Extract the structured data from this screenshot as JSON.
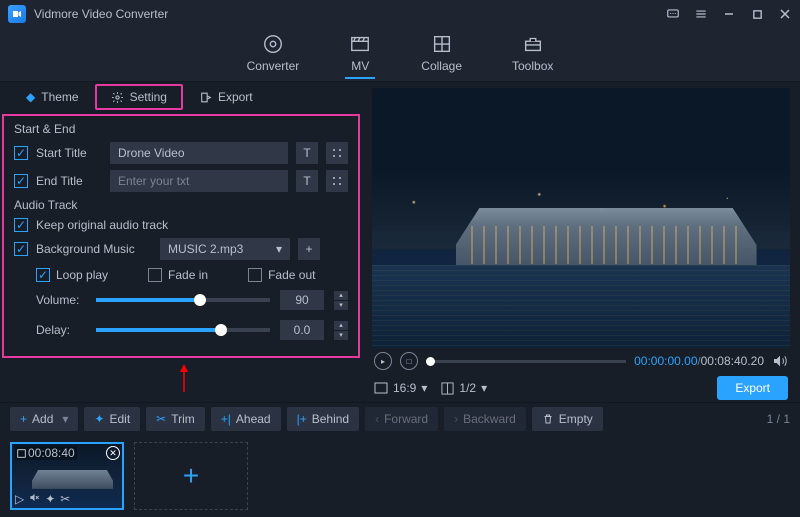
{
  "app": {
    "title": "Vidmore Video Converter"
  },
  "mainTabs": {
    "converter": "Converter",
    "mv": "MV",
    "collage": "Collage",
    "toolbox": "Toolbox"
  },
  "subTabs": {
    "theme": "Theme",
    "setting": "Setting",
    "export": "Export"
  },
  "sections": {
    "startEnd": "Start & End",
    "audioTrack": "Audio Track"
  },
  "fields": {
    "startTitle": {
      "label": "Start Title",
      "value": "Drone Video"
    },
    "endTitle": {
      "label": "End Title",
      "placeholder": "Enter your txt"
    },
    "keepOriginal": "Keep original audio track",
    "bgMusic": {
      "label": "Background Music",
      "value": "MUSIC 2.mp3"
    },
    "loopPlay": "Loop play",
    "fadeIn": "Fade in",
    "fadeOut": "Fade out",
    "volume": {
      "label": "Volume:",
      "value": "90",
      "pct": 60
    },
    "delay": {
      "label": "Delay:",
      "value": "0.0",
      "pct": 72
    }
  },
  "player": {
    "current": "00:00:00.00",
    "total": "00:08:40.20",
    "aspect": "16:9",
    "page": "1/2"
  },
  "buttons": {
    "export": "Export",
    "add": "Add",
    "edit": "Edit",
    "trim": "Trim",
    "ahead": "Ahead",
    "behind": "Behind",
    "forward": "Forward",
    "backward": "Backward",
    "empty": "Empty"
  },
  "pager": "1 / 1",
  "clip": {
    "duration": "00:08:40"
  }
}
